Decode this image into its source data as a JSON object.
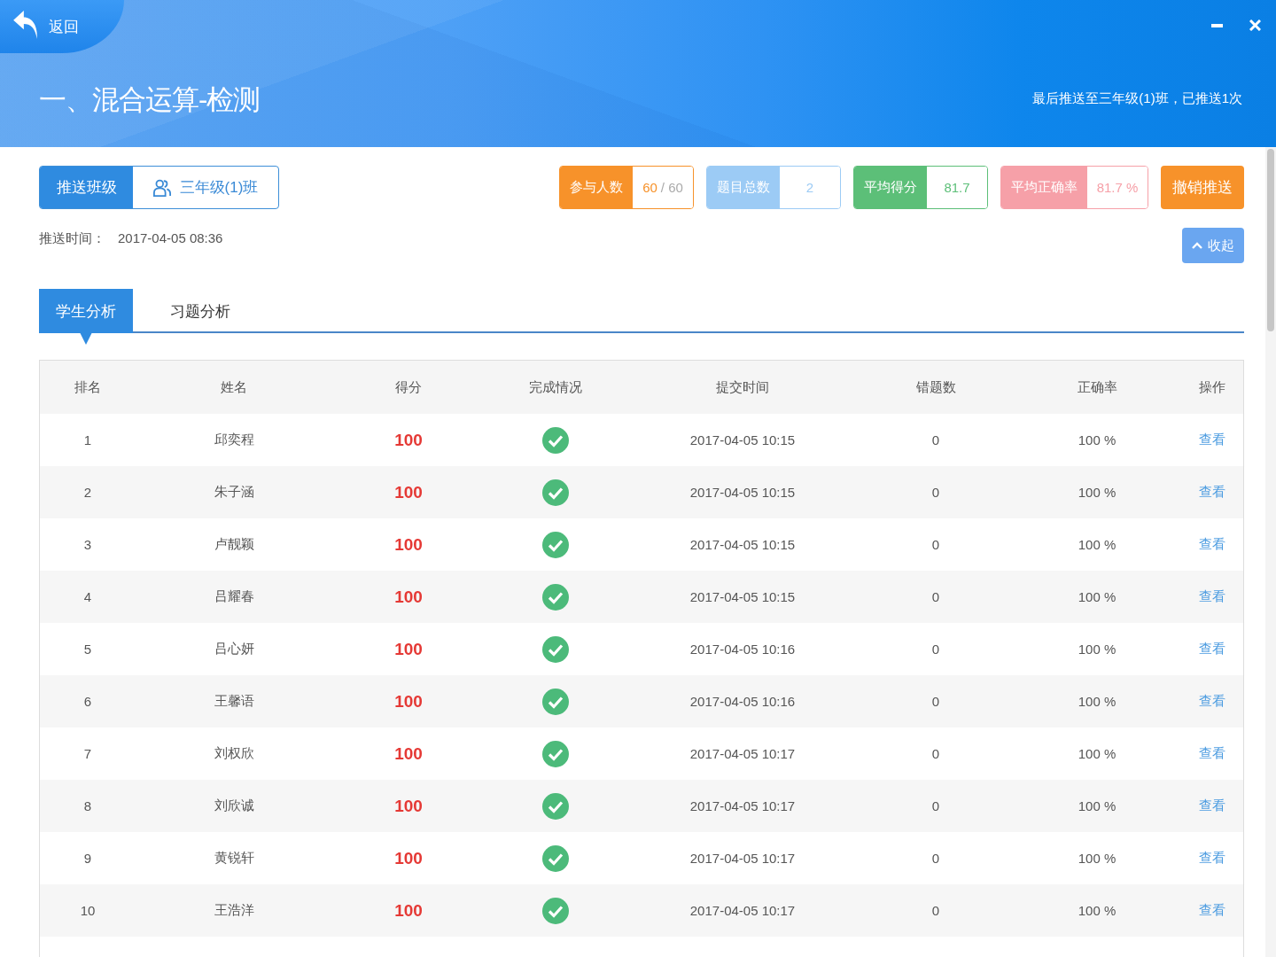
{
  "window": {
    "back_label": "返回",
    "title": "一、混合运算-检测",
    "push_summary": "最后推送至三年级(1)班，已推送1次"
  },
  "push_class": {
    "label": "推送班级",
    "class_name": "三年级(1)班"
  },
  "stats": [
    {
      "label": "参与人数",
      "value": "60",
      "suffix": "/ 60",
      "color": "#f7922a"
    },
    {
      "label": "题目总数",
      "value": "2",
      "color": "#9ccbf5"
    },
    {
      "label": "平均得分",
      "value": "81.7",
      "color": "#5cbf78"
    },
    {
      "label": "平均正确率",
      "value": "81.7 %",
      "color": "#f6a0a8"
    }
  ],
  "revoke_button": "撤销推送",
  "push_time": {
    "label": "推送时间：",
    "value": "2017-04-05 08:36"
  },
  "collapse_button": "收起",
  "tabs": [
    {
      "label": "学生分析",
      "selected": true
    },
    {
      "label": "习题分析",
      "selected": false
    }
  ],
  "table": {
    "columns": [
      "排名",
      "姓名",
      "得分",
      "完成情况",
      "提交时间",
      "错题数",
      "正确率",
      "操作"
    ],
    "rows": [
      {
        "rank": "1",
        "name": "邱奕程",
        "score": "100",
        "completed": true,
        "submit_time": "2017-04-05 10:15",
        "wrong_count": "0",
        "accuracy": "100 %",
        "action": "查看"
      },
      {
        "rank": "2",
        "name": "朱子涵",
        "score": "100",
        "completed": true,
        "submit_time": "2017-04-05 10:15",
        "wrong_count": "0",
        "accuracy": "100 %",
        "action": "查看"
      },
      {
        "rank": "3",
        "name": "卢靓颖",
        "score": "100",
        "completed": true,
        "submit_time": "2017-04-05 10:15",
        "wrong_count": "0",
        "accuracy": "100 %",
        "action": "查看"
      },
      {
        "rank": "4",
        "name": "吕耀春",
        "score": "100",
        "completed": true,
        "submit_time": "2017-04-05 10:15",
        "wrong_count": "0",
        "accuracy": "100 %",
        "action": "查看"
      },
      {
        "rank": "5",
        "name": "吕心妍",
        "score": "100",
        "completed": true,
        "submit_time": "2017-04-05 10:16",
        "wrong_count": "0",
        "accuracy": "100 %",
        "action": "查看"
      },
      {
        "rank": "6",
        "name": "王馨语",
        "score": "100",
        "completed": true,
        "submit_time": "2017-04-05 10:16",
        "wrong_count": "0",
        "accuracy": "100 %",
        "action": "查看"
      },
      {
        "rank": "7",
        "name": "刘权欣",
        "score": "100",
        "completed": true,
        "submit_time": "2017-04-05 10:17",
        "wrong_count": "0",
        "accuracy": "100 %",
        "action": "查看"
      },
      {
        "rank": "8",
        "name": "刘欣诚",
        "score": "100",
        "completed": true,
        "submit_time": "2017-04-05 10:17",
        "wrong_count": "0",
        "accuracy": "100 %",
        "action": "查看"
      },
      {
        "rank": "9",
        "name": "黄锐轩",
        "score": "100",
        "completed": true,
        "submit_time": "2017-04-05 10:17",
        "wrong_count": "0",
        "accuracy": "100 %",
        "action": "查看"
      },
      {
        "rank": "10",
        "name": "王浩洋",
        "score": "100",
        "completed": true,
        "submit_time": "2017-04-05 10:17",
        "wrong_count": "0",
        "accuracy": "100 %",
        "action": "查看"
      }
    ]
  }
}
